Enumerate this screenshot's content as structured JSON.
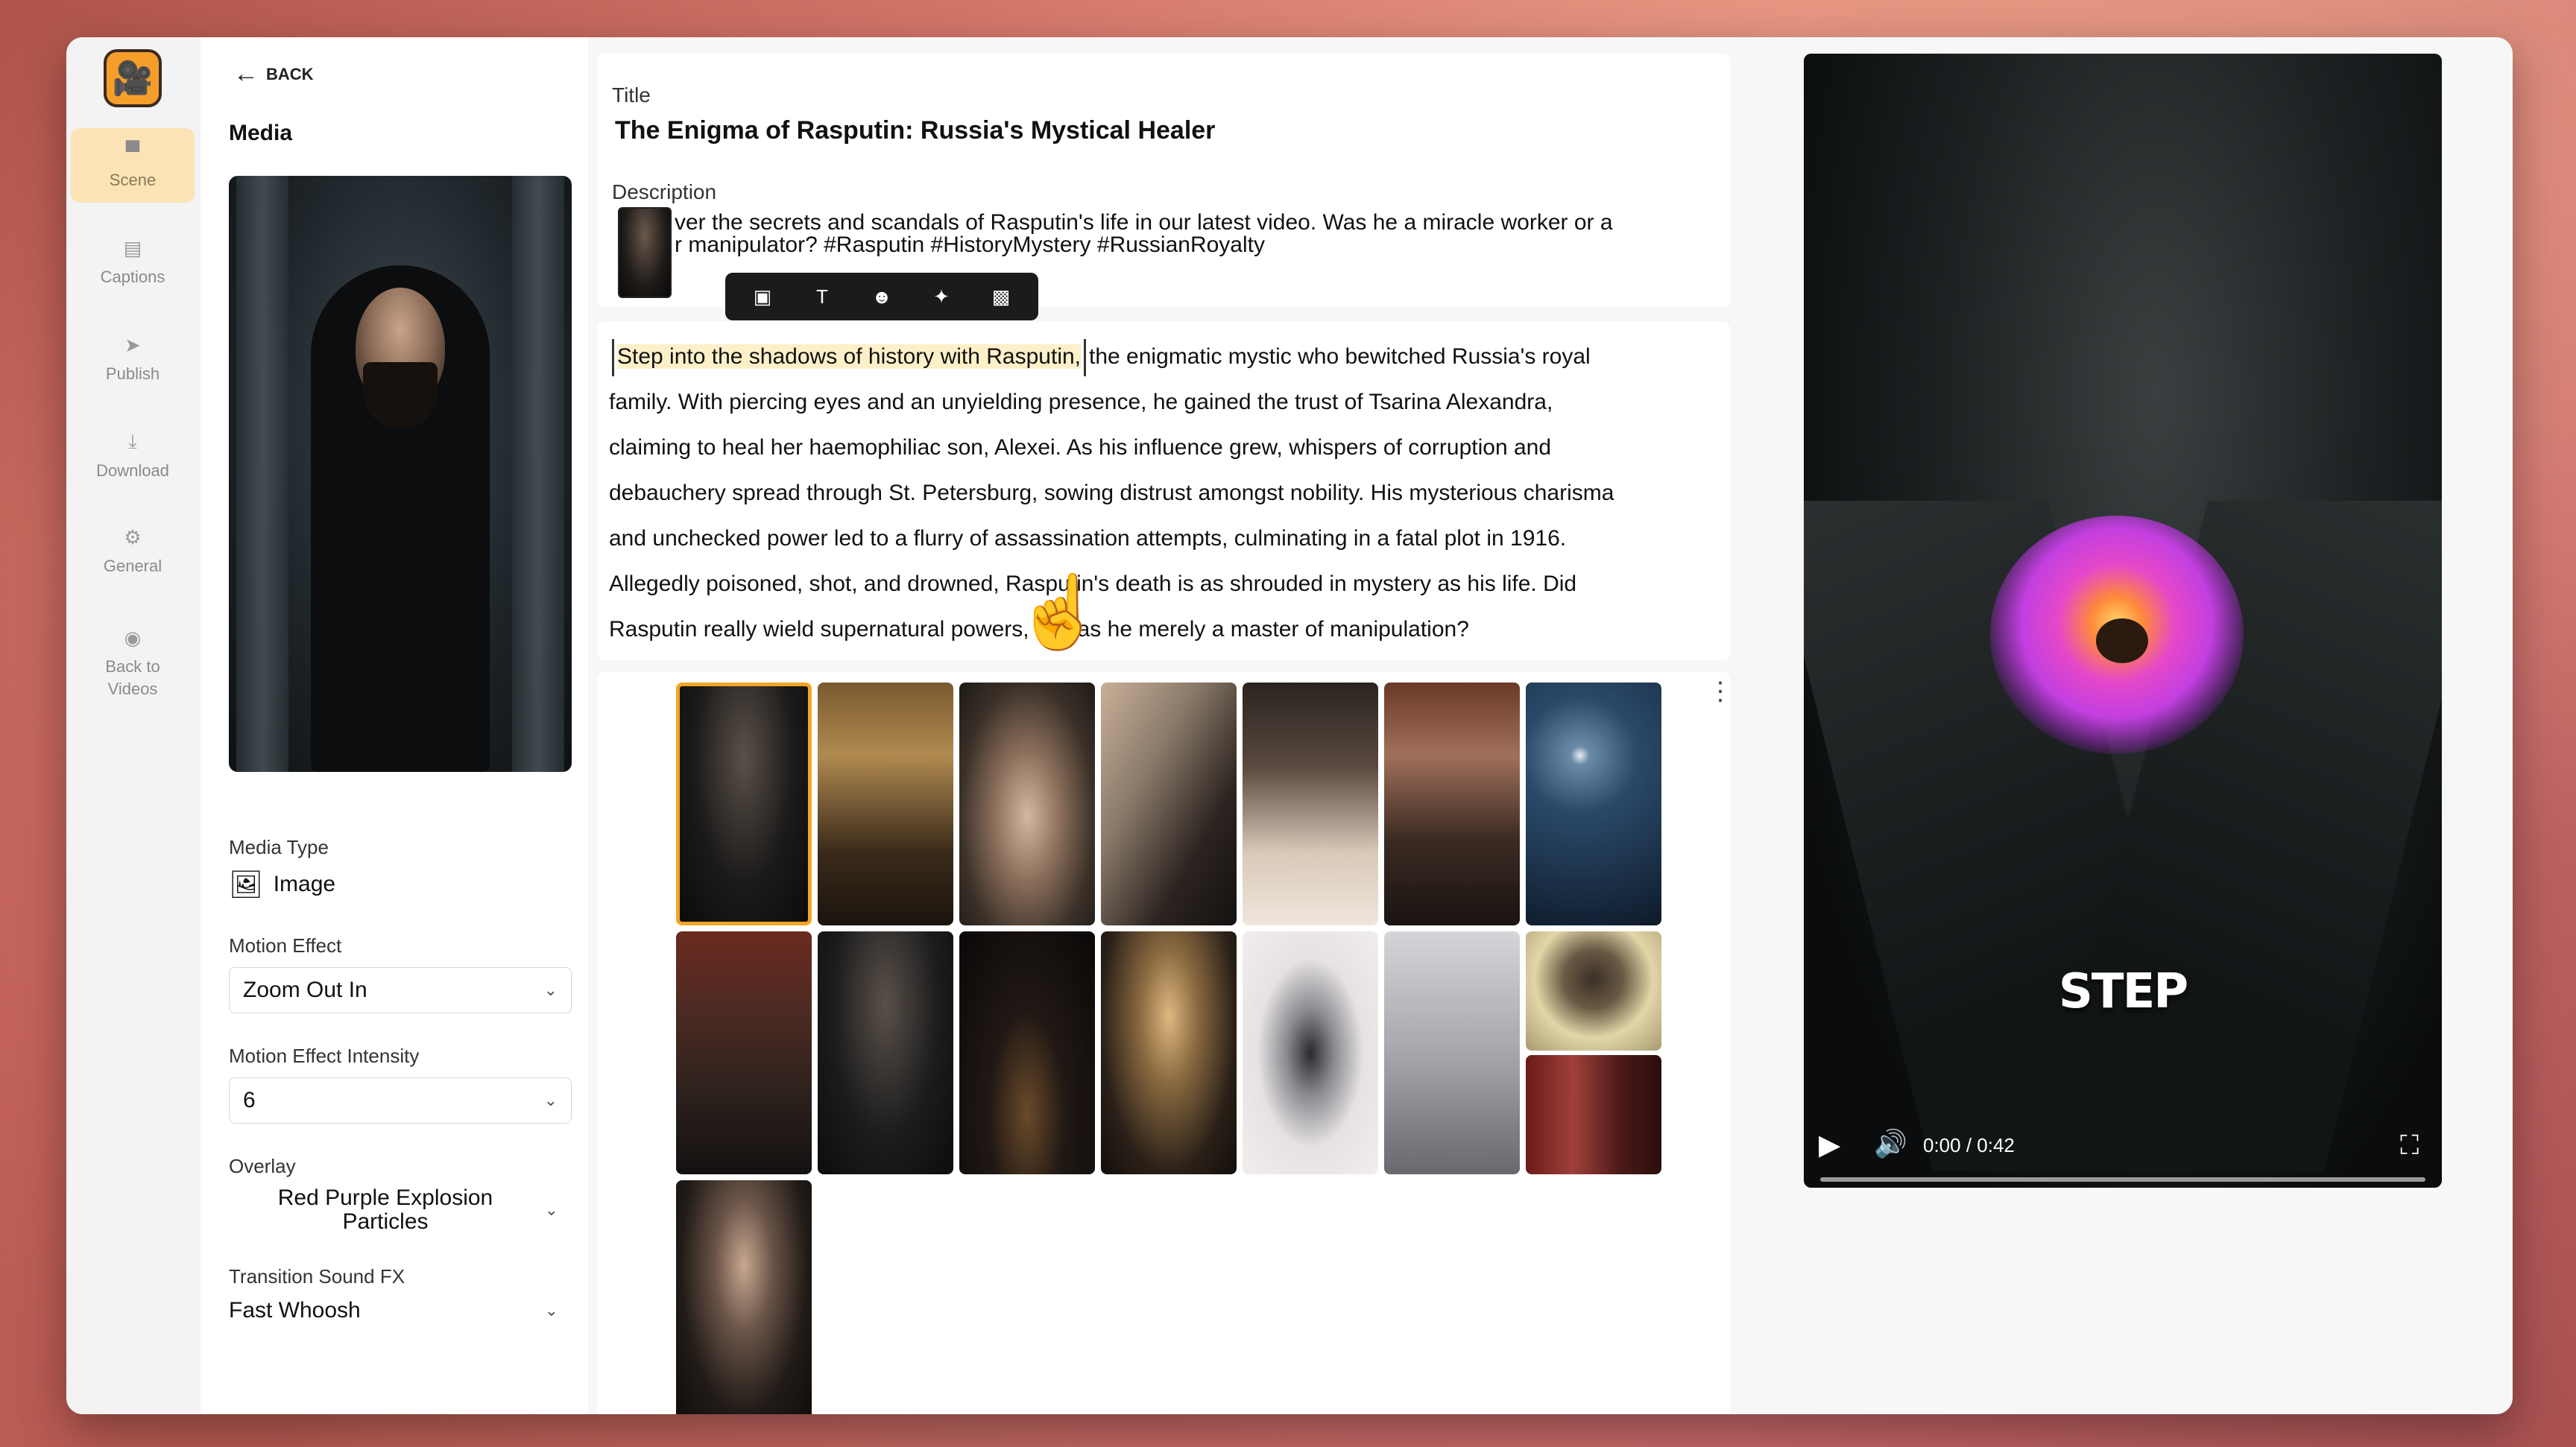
{
  "nav": {
    "items": [
      {
        "label": "Scene",
        "icon": "layers-icon",
        "glyph": "▀"
      },
      {
        "label": "Captions",
        "icon": "captions-icon",
        "glyph": "▤"
      },
      {
        "label": "Publish",
        "icon": "send-icon",
        "glyph": "➤"
      },
      {
        "label": "Download",
        "icon": "download-icon",
        "glyph": "⤓"
      },
      {
        "label": "General",
        "icon": "gear-icon",
        "glyph": "⚙"
      },
      {
        "label": "Back to\nVideos",
        "icon": "back-circle-icon",
        "glyph": "◉"
      }
    ],
    "active": "Scene",
    "accent": "#fbe3b5"
  },
  "media_panel": {
    "back_label": "BACK",
    "heading": "Media",
    "media_type_label": "Media Type",
    "media_type_value": "Image",
    "motion_effect_label": "Motion Effect",
    "motion_effect_value": "Zoom Out In",
    "motion_intensity_label": "Motion Effect Intensity",
    "motion_intensity_value": "6",
    "overlay_label": "Overlay",
    "overlay_value": "Red Purple Explosion Particles",
    "transition_label": "Transition Sound FX",
    "transition_value": "Fast Whoosh"
  },
  "video_meta": {
    "title_label": "Title",
    "title_value": "The Enigma of Rasputin: Russia's Mystical Healer",
    "description_label": "Description",
    "description_line1": "ver the secrets and scandals of Rasputin's life in our latest video. Was he a miracle worker or a",
    "description_line2": "r manipulator? #Rasputin #HistoryMystery #RussianRoyalty"
  },
  "mini_toolbar": {
    "tools": [
      {
        "icon": "image-icon",
        "glyph": "▣"
      },
      {
        "icon": "text-icon",
        "glyph": "T"
      },
      {
        "icon": "avatar-icon",
        "glyph": "☻"
      },
      {
        "icon": "sparkle-icon",
        "glyph": "✦"
      },
      {
        "icon": "image-edit-icon",
        "glyph": "▩"
      }
    ]
  },
  "script": {
    "highlighted": "Step into the shadows of history with Rasputin,",
    "rest_line1": "the enigmatic mystic who bewitched Russia's royal",
    "line2": "family. With piercing eyes and an unyielding presence, he gained the trust of Tsarina Alexandra,",
    "line3": "claiming to heal her haemophiliac son, Alexei. As his influence grew, whispers of corruption and",
    "line4": "debauchery spread through St. Petersburg, sowing distrust amongst nobility. His mysterious charisma",
    "line5": "and unchecked power led to a flurry of assassination attempts, culminating in a fatal plot in 1916.",
    "line6": "Allegedly poisoned, shot, and drowned, Rasputin's death is as shrouded in mystery as his life. Did",
    "line7": "Rasputin really wield supernatural powers, or was he merely a master of manipulation?"
  },
  "thumbnails": {
    "selected_index": 0,
    "count": 16
  },
  "player": {
    "caption": "STEP",
    "time": "0:00 / 0:42",
    "progress": 0.0
  }
}
